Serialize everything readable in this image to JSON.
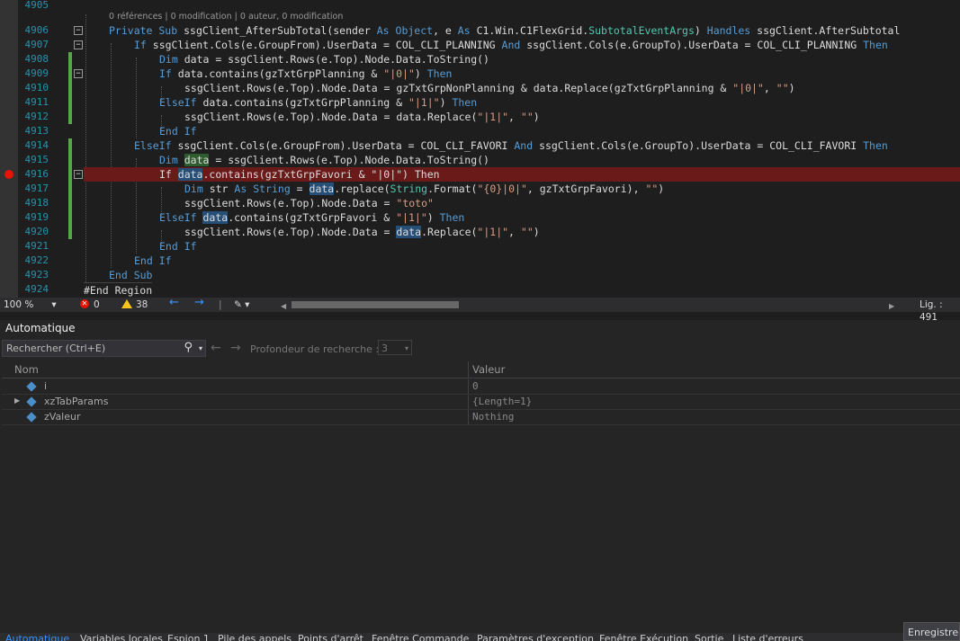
{
  "editor": {
    "codelens": "0 références | 0 modification | 0 auteur, 0 modification",
    "lines": [
      {
        "n": "4905"
      },
      {
        "n": "4906"
      },
      {
        "n": "4907"
      },
      {
        "n": "4908"
      },
      {
        "n": "4909"
      },
      {
        "n": "4910"
      },
      {
        "n": "4911"
      },
      {
        "n": "4912"
      },
      {
        "n": "4913"
      },
      {
        "n": "4914"
      },
      {
        "n": "4915"
      },
      {
        "n": "4916"
      },
      {
        "n": "4917"
      },
      {
        "n": "4918"
      },
      {
        "n": "4919"
      },
      {
        "n": "4920"
      },
      {
        "n": "4921"
      },
      {
        "n": "4922"
      },
      {
        "n": "4923"
      },
      {
        "n": "4924"
      }
    ],
    "region_end": "#End Region",
    "code": {
      "l4906_a": "Private Sub",
      "l4906_b": " ssgClient_AfterSubTotal(sender ",
      "l4906_c": "As",
      "l4906_d": " ",
      "l4906_e": "Object",
      "l4906_f": ", e ",
      "l4906_g": "As",
      "l4906_h": " C1.Win.C1FlexGrid.",
      "l4906_i": "SubtotalEventArgs",
      "l4906_j": ") ",
      "l4906_k": "Handles",
      "l4906_l": " ssgClient.AfterSubtotal",
      "l4907_a": "If",
      "l4907_b": " ssgClient.Cols(e.GroupFrom).UserData = COL_CLI_PLANNING ",
      "l4907_c": "And",
      "l4907_d": " ssgClient.Cols(e.GroupTo).UserData = COL_CLI_PLANNING ",
      "l4907_e": "Then",
      "l4908_a": "Dim",
      "l4908_b": " data = ssgClient.Rows(e.Top).Node.Data.ToString()",
      "l4909_a": "If",
      "l4909_b": " data.contains(gzTxtGrpPlanning & ",
      "l4909_c": "\"|0|\"",
      "l4909_d": ") ",
      "l4909_e": "Then",
      "l4910_a": "ssgClient.Rows(e.Top).Node.Data = gzTxtGrpNonPlanning & data.Replace(gzTxtGrpPlanning & ",
      "l4910_b": "\"|0|\"",
      "l4910_c": ", ",
      "l4910_d": "\"\"",
      "l4910_e": ")",
      "l4911_a": "ElseIf",
      "l4911_b": " data.contains(gzTxtGrpPlanning & ",
      "l4911_c": "\"|1|\"",
      "l4911_d": ") ",
      "l4911_e": "Then",
      "l4912_a": "ssgClient.Rows(e.Top).Node.Data = data.Replace(",
      "l4912_b": "\"|1|\"",
      "l4912_c": ", ",
      "l4912_d": "\"\"",
      "l4912_e": ")",
      "l4913_a": "End If",
      "l4914_a": "ElseIf",
      "l4914_b": " ssgClient.Cols(e.GroupFrom).UserData = COL_CLI_FAVORI ",
      "l4914_c": "And",
      "l4914_d": " ssgClient.Cols(e.GroupTo).UserData = COL_CLI_FAVORI ",
      "l4914_e": "Then",
      "l4915_a": "Dim",
      "l4915_b": "data",
      "l4915_c": " = ssgClient.Rows(e.Top).Node.Data.ToString()",
      "l4916_a": "If ",
      "l4916_b": "data",
      "l4916_c": ".contains(gzTxtGrpFavori & \"|0|\") Then",
      "l4917_a": "Dim",
      "l4917_b": " str ",
      "l4917_c": "As",
      "l4917_d": " ",
      "l4917_e": "String",
      "l4917_f": " = ",
      "l4917_g": "data",
      "l4917_h": ".replace(",
      "l4917_i": "String",
      "l4917_j": ".Format(",
      "l4917_k": "\"{0}|0|\"",
      "l4917_l": ", gzTxtGrpFavori), ",
      "l4917_m": "\"\"",
      "l4917_n": ")",
      "l4918_a": "ssgClient.Rows(e.Top).Node.Data = ",
      "l4918_b": "\"toto\"",
      "l4919_a": "ElseIf",
      "l4919_b": " ",
      "l4919_c": "data",
      "l4919_d": ".contains(gzTxtGrpFavori & ",
      "l4919_e": "\"|1|\"",
      "l4919_f": ") ",
      "l4919_g": "Then",
      "l4920_a": "ssgClient.Rows(e.Top).Node.Data = ",
      "l4920_b": "data",
      "l4920_c": ".Replace(",
      "l4920_d": "\"|1|\"",
      "l4920_e": ", ",
      "l4920_f": "\"\"",
      "l4920_g": ")",
      "l4921_a": "End If",
      "l4922_a": "End If",
      "l4923_a": "End Sub"
    }
  },
  "status": {
    "zoom": "100 %",
    "errors": "0",
    "warnings": "38",
    "position": "Lig. : 491"
  },
  "panel": {
    "title": "Automatique",
    "search_placeholder": "Rechercher (Ctrl+E)",
    "depth_label": "Profondeur de recherche :",
    "depth_value": "3",
    "col_name": "Nom",
    "col_value": "Valeur",
    "rows": [
      {
        "name": "i",
        "value": "0"
      },
      {
        "name": "xzTabParams",
        "value": "{Length=1}"
      },
      {
        "name": "zValeur",
        "value": "Nothing"
      }
    ]
  },
  "tabs": [
    "Automatique",
    "Variables locales",
    "Espion 1",
    "Pile des appels",
    "Points d'arrêt",
    "Fenêtre Commande",
    "Paramètres d'exception",
    "Fenêtre Exécution",
    "Sortie",
    "Liste d'erreurs"
  ],
  "save_label": "Enregistrer",
  "colors": {
    "keyword": "#569cd6",
    "type": "#4ec9b0",
    "string": "#d69d85",
    "breakpoint": "#e51400",
    "accent": "#3794ff"
  }
}
